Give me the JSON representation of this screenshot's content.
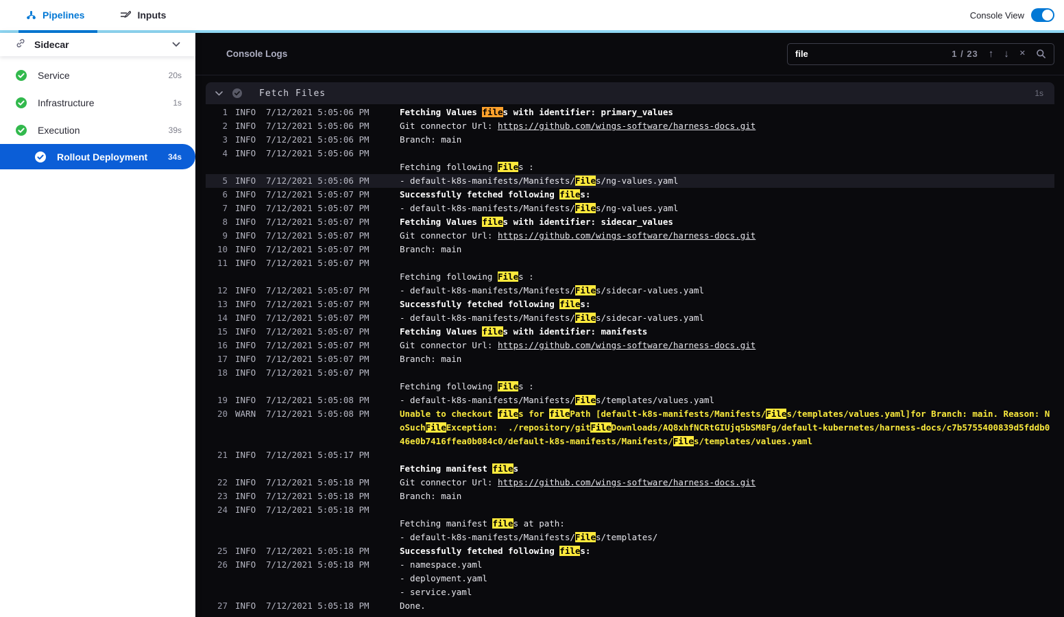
{
  "header": {
    "tabs": [
      {
        "label": "Pipelines",
        "active": true
      },
      {
        "label": "Inputs",
        "active": false
      }
    ],
    "console_view_label": "Console View",
    "console_view_on": true
  },
  "sidebar": {
    "stage_title": "Sidecar",
    "steps": [
      {
        "label": "Service",
        "duration": "20s",
        "status": "success",
        "selected": false
      },
      {
        "label": "Infrastructure",
        "duration": "1s",
        "status": "success",
        "selected": false
      },
      {
        "label": "Execution",
        "duration": "39s",
        "status": "success",
        "selected": false
      },
      {
        "label": "Rollout Deployment",
        "duration": "34s",
        "status": "success",
        "selected": true
      }
    ]
  },
  "console": {
    "title": "Console Logs",
    "search": {
      "value": "file",
      "counter": "1 / 23",
      "prev_icon": "↑",
      "next_icon": "↓",
      "close_icon": "✕"
    },
    "section": {
      "title": "Fetch Files",
      "duration": "1s"
    },
    "highlight": {
      "query": "file",
      "current_occurrence": 0
    },
    "logs": [
      {
        "n": 1,
        "level": "INFO",
        "time": "7/12/2021 5:05:06 PM",
        "msg": "Fetching Values files with identifier: primary_values",
        "bold": true
      },
      {
        "n": 2,
        "level": "INFO",
        "time": "7/12/2021 5:05:06 PM",
        "msg": "Git connector Url: https://github.com/wings-software/harness-docs.git"
      },
      {
        "n": 3,
        "level": "INFO",
        "time": "7/12/2021 5:05:06 PM",
        "msg": "Branch: main"
      },
      {
        "n": 4,
        "level": "INFO",
        "time": "7/12/2021 5:05:06 PM",
        "msg": "\nFetching following Files :"
      },
      {
        "n": 5,
        "level": "INFO",
        "time": "7/12/2021 5:05:06 PM",
        "msg": "- default-k8s-manifests/Manifests/Files/ng-values.yaml",
        "selected": true
      },
      {
        "n": 6,
        "level": "INFO",
        "time": "7/12/2021 5:05:07 PM",
        "msg": "Successfully fetched following files:",
        "bold": true
      },
      {
        "n": 7,
        "level": "INFO",
        "time": "7/12/2021 5:05:07 PM",
        "msg": "- default-k8s-manifests/Manifests/Files/ng-values.yaml"
      },
      {
        "n": 8,
        "level": "INFO",
        "time": "7/12/2021 5:05:07 PM",
        "msg": "Fetching Values files with identifier: sidecar_values",
        "bold": true
      },
      {
        "n": 9,
        "level": "INFO",
        "time": "7/12/2021 5:05:07 PM",
        "msg": "Git connector Url: https://github.com/wings-software/harness-docs.git"
      },
      {
        "n": 10,
        "level": "INFO",
        "time": "7/12/2021 5:05:07 PM",
        "msg": "Branch: main"
      },
      {
        "n": 11,
        "level": "INFO",
        "time": "7/12/2021 5:05:07 PM",
        "msg": "\nFetching following Files :"
      },
      {
        "n": 12,
        "level": "INFO",
        "time": "7/12/2021 5:05:07 PM",
        "msg": "- default-k8s-manifests/Manifests/Files/sidecar-values.yaml"
      },
      {
        "n": 13,
        "level": "INFO",
        "time": "7/12/2021 5:05:07 PM",
        "msg": "Successfully fetched following files:",
        "bold": true
      },
      {
        "n": 14,
        "level": "INFO",
        "time": "7/12/2021 5:05:07 PM",
        "msg": "- default-k8s-manifests/Manifests/Files/sidecar-values.yaml"
      },
      {
        "n": 15,
        "level": "INFO",
        "time": "7/12/2021 5:05:07 PM",
        "msg": "Fetching Values files with identifier: manifests",
        "bold": true
      },
      {
        "n": 16,
        "level": "INFO",
        "time": "7/12/2021 5:05:07 PM",
        "msg": "Git connector Url: https://github.com/wings-software/harness-docs.git"
      },
      {
        "n": 17,
        "level": "INFO",
        "time": "7/12/2021 5:05:07 PM",
        "msg": "Branch: main"
      },
      {
        "n": 18,
        "level": "INFO",
        "time": "7/12/2021 5:05:07 PM",
        "msg": "\nFetching following Files :"
      },
      {
        "n": 19,
        "level": "INFO",
        "time": "7/12/2021 5:05:08 PM",
        "msg": "- default-k8s-manifests/Manifests/Files/templates/values.yaml"
      },
      {
        "n": 20,
        "level": "WARN",
        "time": "7/12/2021 5:05:08 PM",
        "msg": "Unable to checkout files for filePath [default-k8s-manifests/Manifests/Files/templates/values.yaml]for Branch: main. Reason: NoSuchFileException:  ./repository/gitFileDownloads/AQ8xhfNCRtGIUjq5bSM8Fg/default-kubernetes/harness-docs/c7b5755400839d5fddb046e0b7416ffea0b084c0/default-k8s-manifests/Manifests/Files/templates/values.yaml"
      },
      {
        "n": 21,
        "level": "INFO",
        "time": "7/12/2021 5:05:17 PM",
        "msg": "\nFetching manifest files",
        "bold": true
      },
      {
        "n": 22,
        "level": "INFO",
        "time": "7/12/2021 5:05:18 PM",
        "msg": "Git connector Url: https://github.com/wings-software/harness-docs.git"
      },
      {
        "n": 23,
        "level": "INFO",
        "time": "7/12/2021 5:05:18 PM",
        "msg": "Branch: main"
      },
      {
        "n": 24,
        "level": "INFO",
        "time": "7/12/2021 5:05:18 PM",
        "msg": "\nFetching manifest files at path:\n- default-k8s-manifests/Manifests/Files/templates/"
      },
      {
        "n": 25,
        "level": "INFO",
        "time": "7/12/2021 5:05:18 PM",
        "msg": "Successfully fetched following files:",
        "bold": true
      },
      {
        "n": 26,
        "level": "INFO",
        "time": "7/12/2021 5:05:18 PM",
        "msg": "- namespace.yaml\n- deployment.yaml\n- service.yaml"
      },
      {
        "n": 27,
        "level": "INFO",
        "time": "7/12/2021 5:05:18 PM",
        "msg": "Done."
      }
    ]
  },
  "colors": {
    "primary_blue": "#0278d5",
    "accent_light_blue": "#8ed6f2",
    "selected_step_blue": "#0b5ed7",
    "success_green": "#32b94d",
    "console_bg": "#0a0a0d",
    "warn_text": "#f9e93d",
    "match_highlight": "#fde93c",
    "current_match_highlight": "#ffa12c"
  }
}
